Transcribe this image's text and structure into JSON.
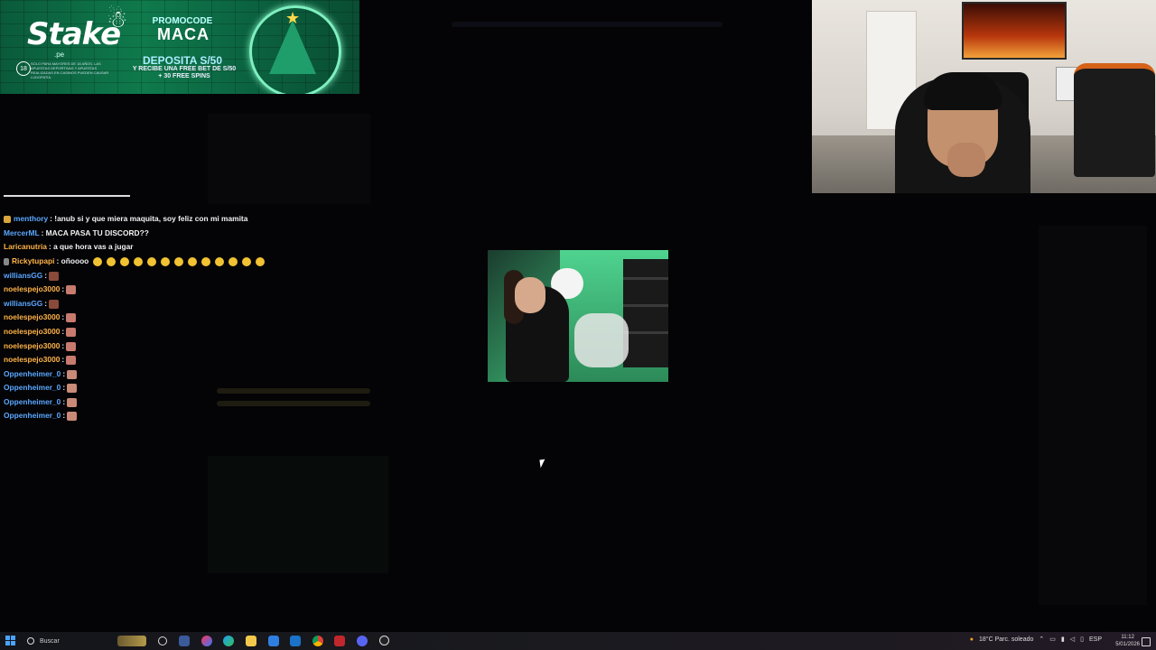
{
  "banner": {
    "brand": "Stake",
    "brand_sub": ".pe",
    "promo_label": "PROMOCODE",
    "promo_code": "MACA",
    "deposit": "DEPOSITA S/50",
    "fine_print": "Y RECIBE UNA FREE BET DE S/50 + 30 FREE SPINS",
    "age": "18",
    "legal": "SOLO PARA MAYORES DE 18 AÑOS. LAS APUESTAS DEPORTIVAS Y APUESTAS REALIZADAS EN CASINOS PUEDEN CAUSAR LUDOPATÍA."
  },
  "chat": {
    "messages": [
      {
        "user": "menthory",
        "color": "#5aa7ff",
        "badge": "gold",
        "text": ": !anub si y que miera maquita, soy feliz con mi mamita",
        "emotes": []
      },
      {
        "user": "MercerML",
        "color": "#5aa7ff",
        "badge": "",
        "text": ": MACA PASA TU DISCORD??",
        "emotes": []
      },
      {
        "user": "Laricanutria",
        "color": "#ffb347",
        "badge": "",
        "text": ": a que hora vas a jugar",
        "emotes": []
      },
      {
        "user": "Rickytupapi",
        "color": "#ffb347",
        "badge": "gray",
        "text": ": oñoooo",
        "emotes": [
          "yellow",
          "yellow",
          "yellow",
          "yellow",
          "yellow",
          "yellow",
          "yellow",
          "yellow",
          "yellow",
          "yellow",
          "yellow",
          "yellow",
          "yellow"
        ]
      },
      {
        "user": "williansGG",
        "color": "#5aa7ff",
        "badge": "",
        "text": ":",
        "emotes": [
          "brown"
        ]
      },
      {
        "user": "noelespejo3000",
        "color": "#ffb347",
        "badge": "",
        "text": ":",
        "emotes": [
          "hand"
        ]
      },
      {
        "user": "williansGG",
        "color": "#5aa7ff",
        "badge": "",
        "text": ":",
        "emotes": [
          "brown"
        ]
      },
      {
        "user": "noelespejo3000",
        "color": "#ffb347",
        "badge": "",
        "text": ":",
        "emotes": [
          "hand"
        ]
      },
      {
        "user": "noelespejo3000",
        "color": "#ffb347",
        "badge": "",
        "text": ":",
        "emotes": [
          "hand"
        ]
      },
      {
        "user": "noelespejo3000",
        "color": "#ffb347",
        "badge": "",
        "text": ":",
        "emotes": [
          "hand"
        ]
      },
      {
        "user": "noelespejo3000",
        "color": "#ffb347",
        "badge": "",
        "text": ":",
        "emotes": [
          "hand"
        ]
      },
      {
        "user": "Oppenheimer_0",
        "color": "#5aa7ff",
        "badge": "",
        "text": ":",
        "emotes": [
          "face"
        ]
      },
      {
        "user": "Oppenheimer_0",
        "color": "#5aa7ff",
        "badge": "",
        "text": ":",
        "emotes": [
          "face"
        ]
      },
      {
        "user": "Oppenheimer_0",
        "color": "#5aa7ff",
        "badge": "",
        "text": ":",
        "emotes": [
          "face"
        ]
      },
      {
        "user": "Oppenheimer_0",
        "color": "#5aa7ff",
        "badge": "",
        "text": ":",
        "emotes": [
          "face"
        ]
      }
    ]
  },
  "taskbar": {
    "search_placeholder": "Buscar",
    "weather": "18°C  Parc. soleado",
    "lang": "ESP",
    "time": "11:12",
    "date": "5/01/2026",
    "apps": [
      "file-explorer-icon",
      "copilot-icon",
      "edge-icon",
      "outlook-icon",
      "chrome-icon",
      "filmora-icon",
      "discord-icon",
      "obs-icon"
    ]
  }
}
